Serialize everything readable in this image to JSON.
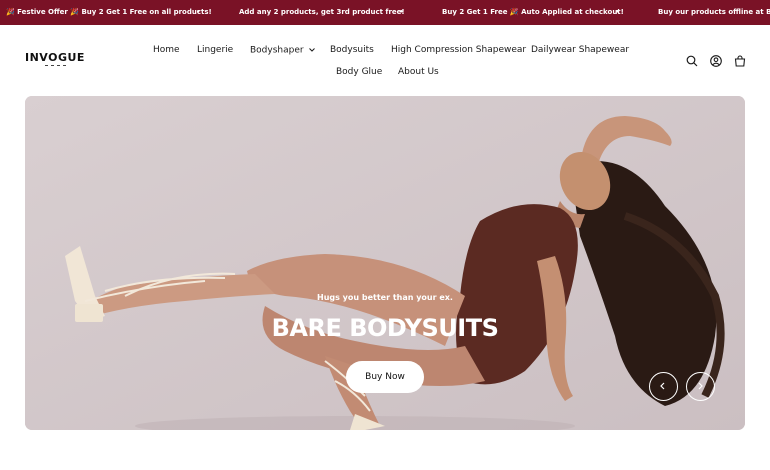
{
  "announcement": {
    "messages": [
      "🎉 Festive Offer 🎉 Buy 2 Get 1 Free on all products!",
      "Add any 2 products, get 3rd product free!",
      "Buy 2 Get 1 Free 🎉 Auto Applied at checkout!",
      "Buy our products offline at Broadway,"
    ],
    "separator": "•"
  },
  "logo": {
    "wordmark": "INVOGUE"
  },
  "nav": {
    "items": [
      "Home",
      "Lingerie",
      "Bodyshaper",
      "Bodysuits",
      "High Compression Shapewear",
      "Dailywear Shapewear",
      "Body Glue",
      "About Us"
    ]
  },
  "header_icons": [
    "search-icon",
    "account-icon",
    "cart-icon"
  ],
  "hero": {
    "tagline": "Hugs you better than your ex.",
    "title": "BARE BODYSUITS",
    "cta_label": "Buy Now"
  },
  "colors": {
    "announcement_bg": "#7a1226",
    "hero_bg": "#d7ccce",
    "bodysuit": "#5b2a22"
  }
}
